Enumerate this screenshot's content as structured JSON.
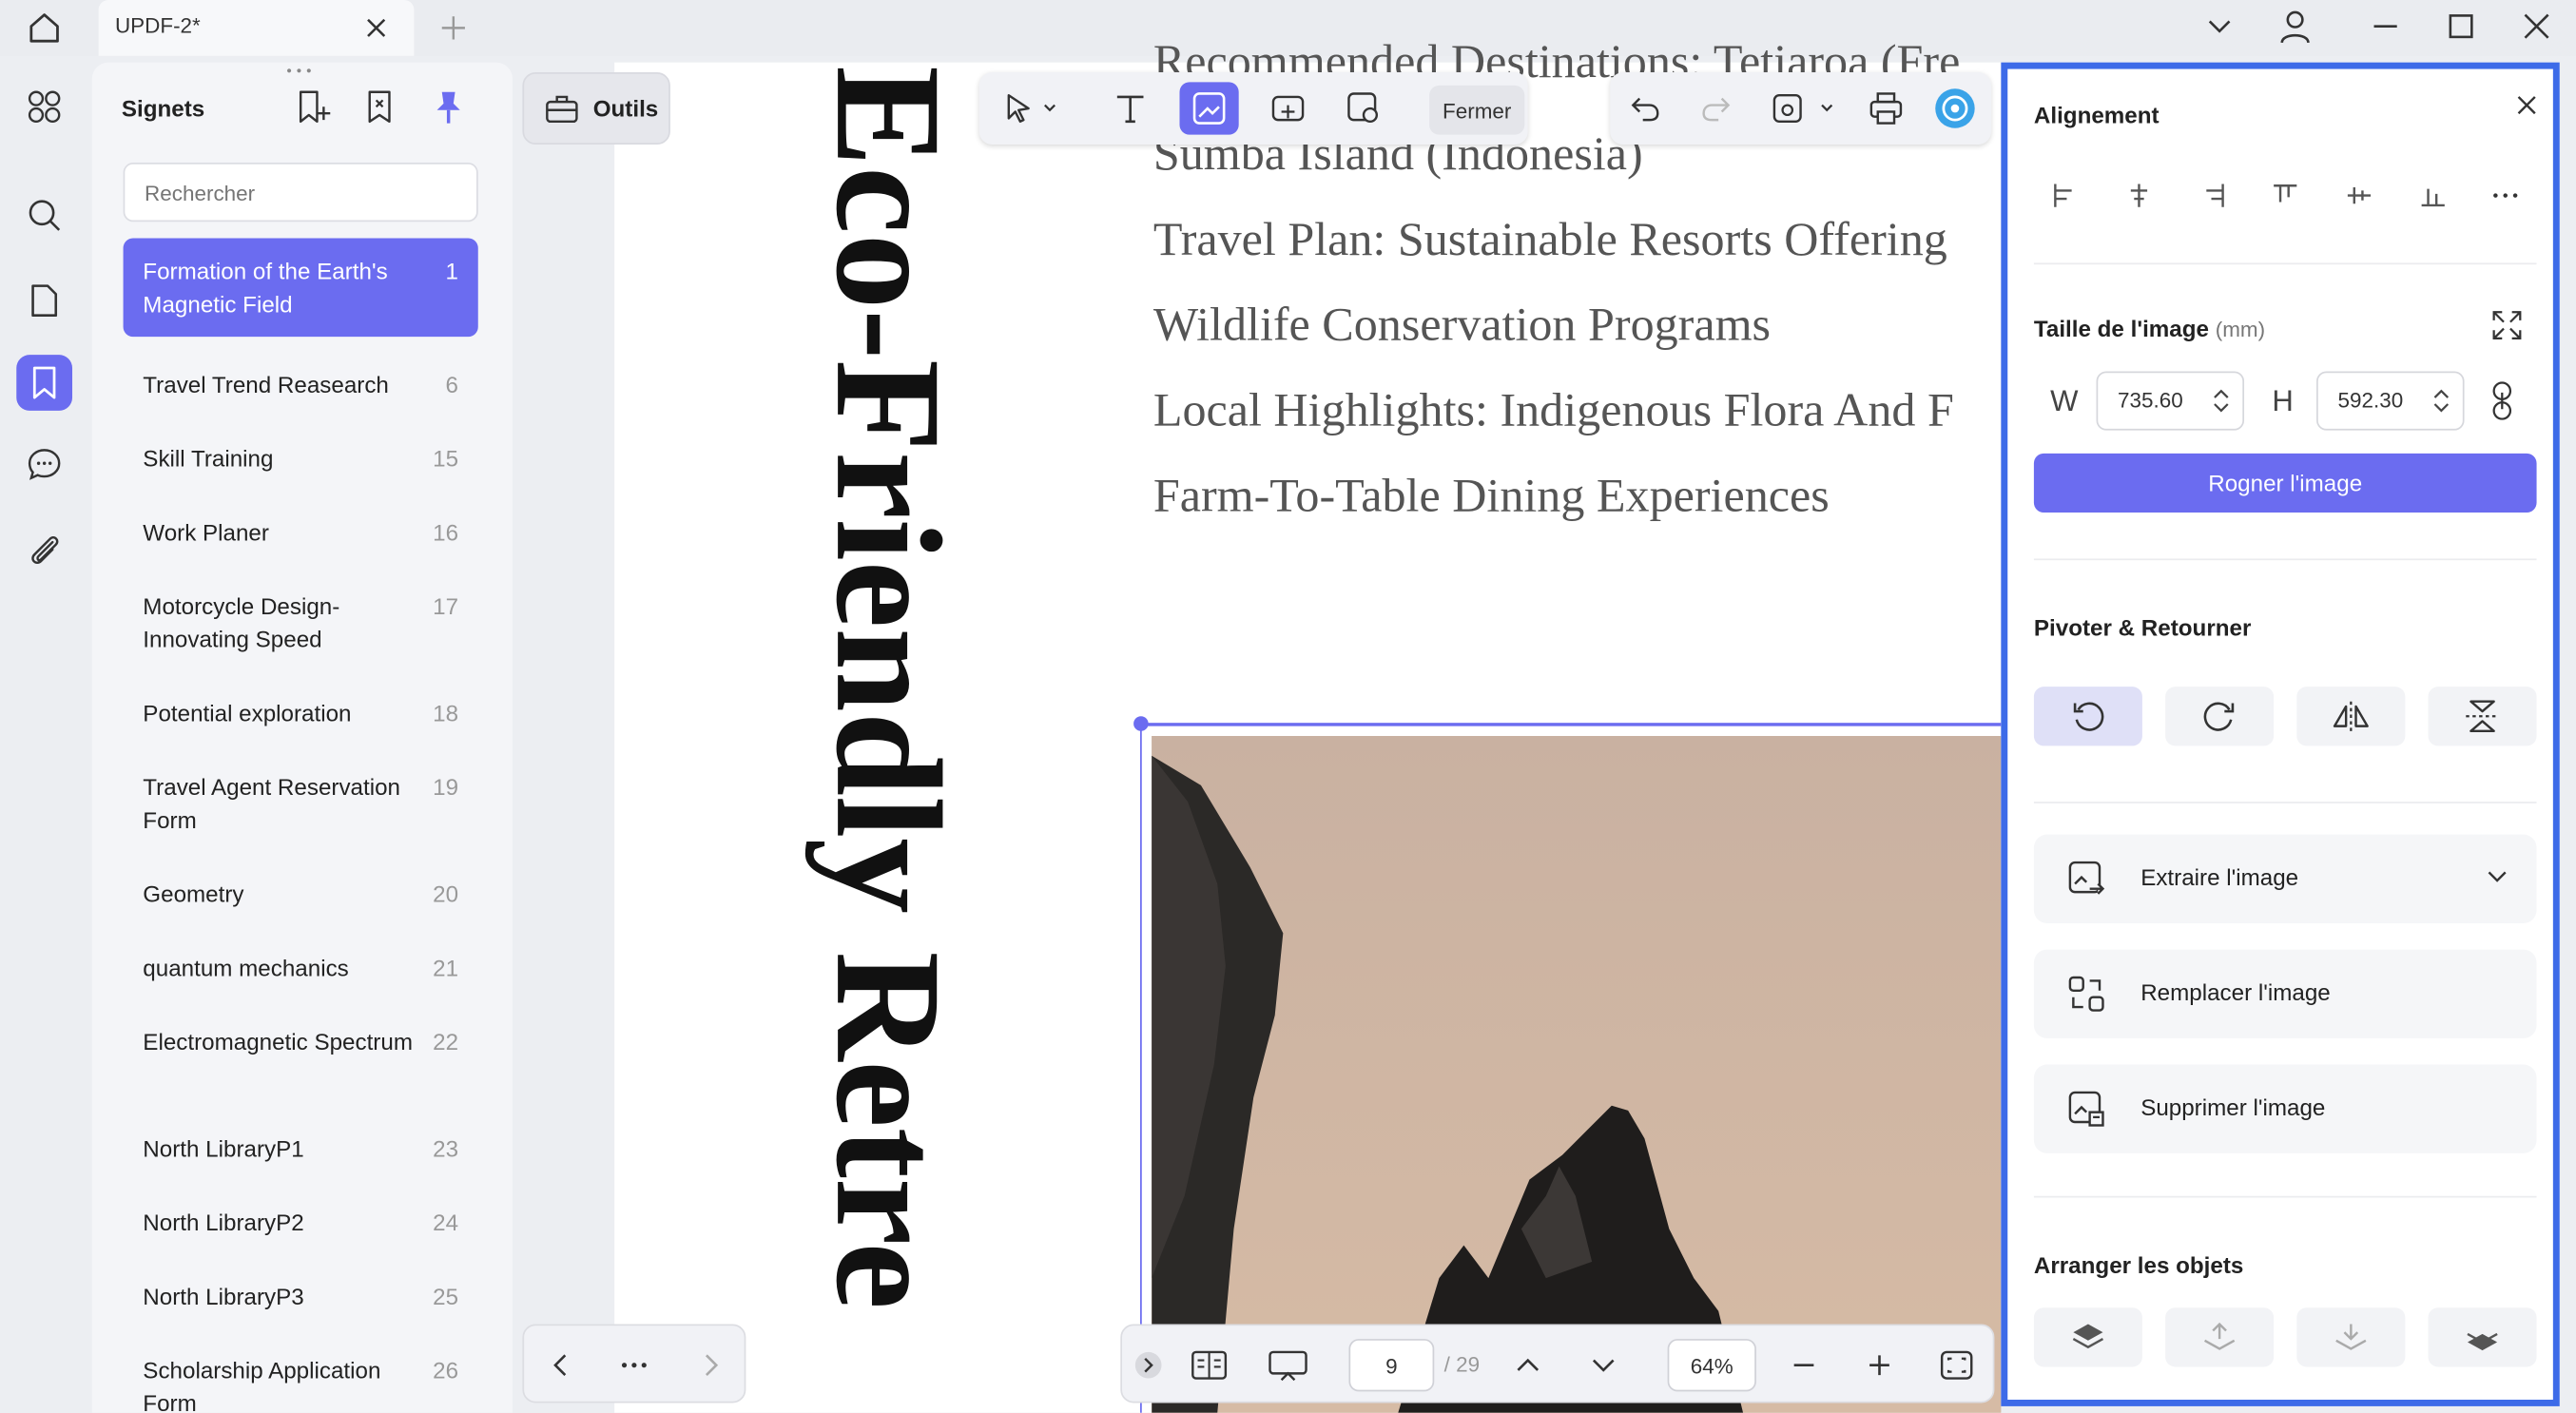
{
  "window": {
    "tab_title": "UPDF-2*"
  },
  "sidebar": {
    "title": "Signets",
    "search_placeholder": "Rechercher",
    "items": [
      {
        "label": "Formation of the Earth's Magnetic Field",
        "page": "1",
        "selected": true
      },
      {
        "label": "Travel Trend Reasearch",
        "page": "6"
      },
      {
        "label": "Skill Training",
        "page": "15"
      },
      {
        "label": "Work Planer",
        "page": "16"
      },
      {
        "label": "Motorcycle Design-Innovating Speed",
        "page": "17"
      },
      {
        "label": "Potential exploration",
        "page": "18"
      },
      {
        "label": "Travel Agent Reservation Form",
        "page": "19"
      },
      {
        "label": "Geometry",
        "page": "20"
      },
      {
        "label": "quantum mechanics",
        "page": "21"
      },
      {
        "label": "Electromagnetic Spectrum",
        "page": "22"
      },
      {
        "label": "North LibraryP1",
        "page": "23"
      },
      {
        "label": "North LibraryP2",
        "page": "24"
      },
      {
        "label": "North LibraryP3",
        "page": "25"
      },
      {
        "label": "Scholarship Application Form",
        "page": "26"
      }
    ]
  },
  "toolbar": {
    "tools_label": "Outils",
    "close_label": "Fermer"
  },
  "document": {
    "vertical_title": "Eco-Friendly Retre",
    "lines": [
      "Recommended Destinations: Tetiaroa (Fre",
      "Sumba Island (Indonesia)",
      "Travel Plan: Sustainable Resorts Offering",
      "Wildlife Conservation Programs",
      "Local Highlights: Indigenous Flora And F",
      "Farm-To-Table Dining Experiences"
    ]
  },
  "bottombar": {
    "page_current": "9",
    "page_total": "/ 29",
    "zoom": "64%"
  },
  "panel": {
    "alignment_title": "Alignement",
    "size_title": "Taille de l'image",
    "size_unit": "(mm)",
    "w_label": "W",
    "w_value": "735.60",
    "h_label": "H",
    "h_value": "592.30",
    "crop_button": "Rogner l'image",
    "rotate_title": "Pivoter & Retourner",
    "actions": [
      "Extraire l'image",
      "Remplacer l'image",
      "Supprimer l'image"
    ],
    "arrange_title": "Arranger les objets"
  },
  "colors": {
    "accent": "#6b6cf0",
    "panel_border": "#3d6be8"
  }
}
